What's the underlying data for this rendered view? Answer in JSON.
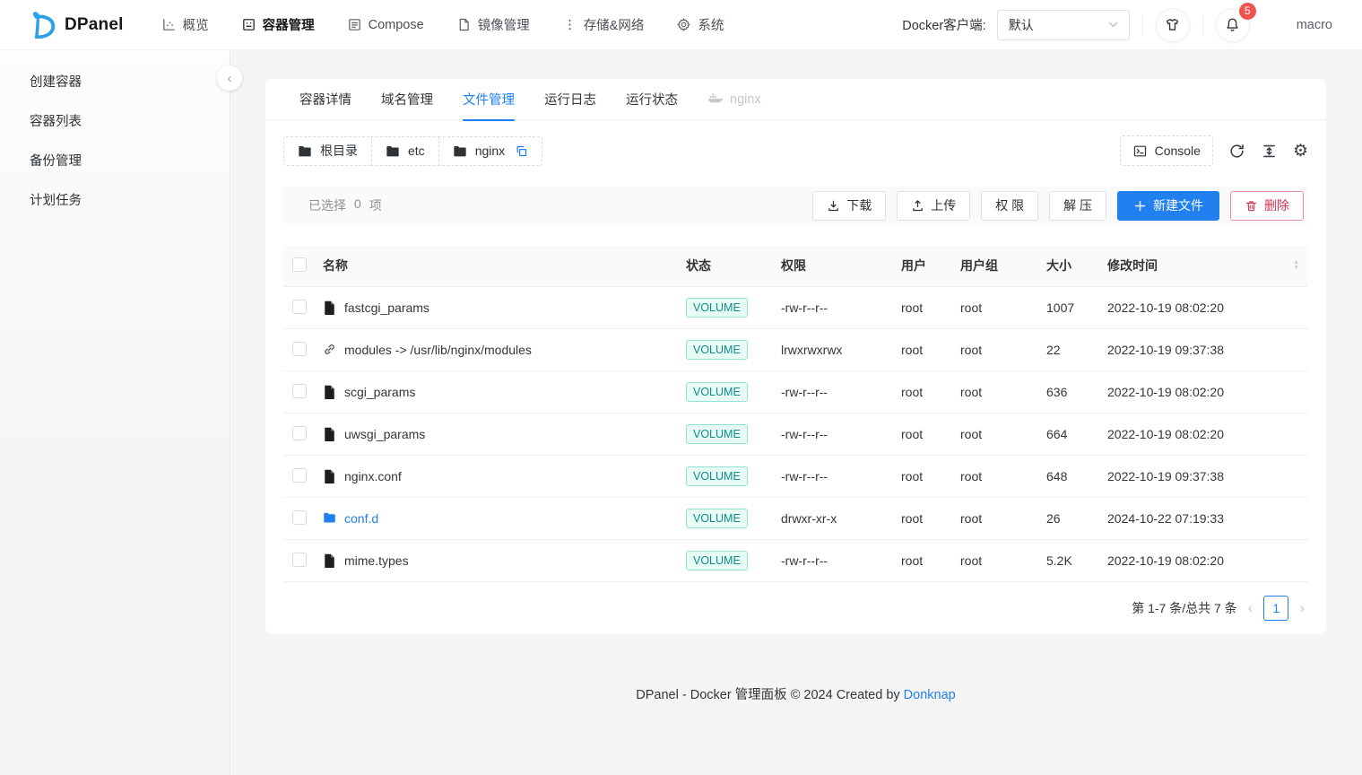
{
  "header": {
    "brand": "DPanel",
    "nav": [
      {
        "id": "overview",
        "label": "概览",
        "icon": "chart-icon",
        "active": false
      },
      {
        "id": "containers",
        "label": "容器管理",
        "icon": "container-icon",
        "active": true
      },
      {
        "id": "compose",
        "label": "Compose",
        "icon": "compose-icon",
        "active": false
      },
      {
        "id": "images",
        "label": "镜像管理",
        "icon": "image-icon",
        "active": false
      },
      {
        "id": "storage",
        "label": "存储&网络",
        "icon": "dots-icon",
        "active": false
      },
      {
        "id": "system",
        "label": "系统",
        "icon": "gear-icon",
        "active": false
      }
    ],
    "client_label": "Docker客户端:",
    "client_value": "默认",
    "notification_count": "5",
    "username": "macro"
  },
  "sidebar": {
    "items": [
      {
        "id": "create-container",
        "label": "创建容器"
      },
      {
        "id": "container-list",
        "label": "容器列表"
      },
      {
        "id": "backup",
        "label": "备份管理"
      },
      {
        "id": "scheduled-tasks",
        "label": "计划任务"
      }
    ]
  },
  "tabs": [
    {
      "id": "container-detail",
      "label": "容器详情",
      "active": false
    },
    {
      "id": "domain",
      "label": "域名管理",
      "active": false
    },
    {
      "id": "files",
      "label": "文件管理",
      "active": true
    },
    {
      "id": "logs",
      "label": "运行日志",
      "active": false
    },
    {
      "id": "status",
      "label": "运行状态",
      "active": false
    }
  ],
  "container_label": "nginx",
  "breadcrumb": {
    "segments": [
      "根目录",
      "etc",
      "nginx"
    ]
  },
  "toolbar": {
    "console_label": "Console"
  },
  "selection": {
    "prefix": "已选择",
    "count": "0",
    "suffix": "项"
  },
  "actions": {
    "download": "下载",
    "upload": "上传",
    "permission": "权 限",
    "unzip": "解 压",
    "new_file": "新建文件",
    "delete": "删除"
  },
  "table": {
    "columns": {
      "name": "名称",
      "status": "状态",
      "perm": "权限",
      "user": "用户",
      "group": "用户组",
      "size": "大小",
      "mtime": "修改时间"
    },
    "rows": [
      {
        "type": "file",
        "name": "fastcgi_params",
        "status": "VOLUME",
        "perm": "-rw-r--r--",
        "user": "root",
        "group": "root",
        "size": "1007",
        "mtime": "2022-10-19 08:02:20"
      },
      {
        "type": "link",
        "name": "modules -> /usr/lib/nginx/modules",
        "status": "VOLUME",
        "perm": "lrwxrwxrwx",
        "user": "root",
        "group": "root",
        "size": "22",
        "mtime": "2022-10-19 09:37:38"
      },
      {
        "type": "file",
        "name": "scgi_params",
        "status": "VOLUME",
        "perm": "-rw-r--r--",
        "user": "root",
        "group": "root",
        "size": "636",
        "mtime": "2022-10-19 08:02:20"
      },
      {
        "type": "file",
        "name": "uwsgi_params",
        "status": "VOLUME",
        "perm": "-rw-r--r--",
        "user": "root",
        "group": "root",
        "size": "664",
        "mtime": "2022-10-19 08:02:20"
      },
      {
        "type": "file",
        "name": "nginx.conf",
        "status": "VOLUME",
        "perm": "-rw-r--r--",
        "user": "root",
        "group": "root",
        "size": "648",
        "mtime": "2022-10-19 09:37:38"
      },
      {
        "type": "folder",
        "name": "conf.d",
        "status": "VOLUME",
        "perm": "drwxr-xr-x",
        "user": "root",
        "group": "root",
        "size": "26",
        "mtime": "2024-10-22 07:19:33"
      },
      {
        "type": "file",
        "name": "mime.types",
        "status": "VOLUME",
        "perm": "-rw-r--r--",
        "user": "root",
        "group": "root",
        "size": "5.2K",
        "mtime": "2022-10-19 08:02:20"
      }
    ]
  },
  "pagination": {
    "total_text": "第 1-7 条/总共 7 条",
    "page": "1"
  },
  "footer": {
    "text": "DPanel - Docker 管理面板 © 2024 Created by ",
    "link": "Donknap"
  },
  "colors": {
    "primary": "#2080f0",
    "danger": "#d03050",
    "badge": "#f0544f",
    "tag_text": "#108a8a",
    "tag_bg": "#e8fcf6",
    "tag_border": "#93e3d5",
    "logo_blue": "#2b9fe8"
  }
}
